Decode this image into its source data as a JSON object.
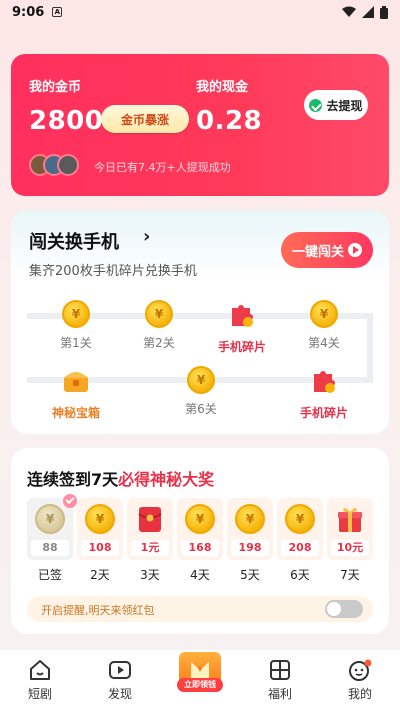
{
  "status_bar": {
    "time": "9:06",
    "notif": "A"
  },
  "coins": {
    "coin_label": "我的金币",
    "coin_value": "2800",
    "surge_label": "金币暴涨",
    "cash_label": "我的现金",
    "cash_value": "0.28",
    "withdraw_label": "去提现",
    "ticker": "今日已有7.4万+人提现成功"
  },
  "challenge": {
    "title": "闯关换手机",
    "subtitle": "集齐200枚手机碎片兑换手机",
    "onekey_label": "一键闯关",
    "row1": [
      {
        "label": "第1关",
        "type": "coin"
      },
      {
        "label": "第2关",
        "type": "coin"
      },
      {
        "label": "手机碎片",
        "type": "puzzle"
      },
      {
        "label": "第4关",
        "type": "coin"
      }
    ],
    "row2": [
      {
        "label": "神秘宝箱",
        "type": "chest"
      },
      {
        "label": "第6关",
        "type": "coin"
      },
      {
        "label": "手机碎片",
        "type": "puzzle"
      }
    ]
  },
  "signin": {
    "title_prefix": "连续签到7天",
    "title_highlight": "必得神秘大奖",
    "days": [
      {
        "amount": "88",
        "label": "已签",
        "type": "coin",
        "done": true
      },
      {
        "amount": "108",
        "label": "2天",
        "type": "coin",
        "done": false
      },
      {
        "amount": "1元",
        "label": "3天",
        "type": "envelope",
        "done": false
      },
      {
        "amount": "168",
        "label": "4天",
        "type": "coin",
        "done": false
      },
      {
        "amount": "198",
        "label": "5天",
        "type": "coin",
        "done": false
      },
      {
        "amount": "208",
        "label": "6天",
        "type": "coin",
        "done": false
      },
      {
        "amount": "10元",
        "label": "7天",
        "type": "gift",
        "done": false
      }
    ],
    "remind_text": "开启提醒,明天来领红包",
    "remind_on": false
  },
  "nav": {
    "items": [
      {
        "label": "短剧",
        "icon": "home-icon"
      },
      {
        "label": "发现",
        "icon": "play-icon"
      },
      {
        "label": "立即领钱",
        "icon": "money-box-icon"
      },
      {
        "label": "福利",
        "icon": "gift-grid-icon"
      },
      {
        "label": "我的",
        "icon": "profile-icon"
      }
    ]
  }
}
